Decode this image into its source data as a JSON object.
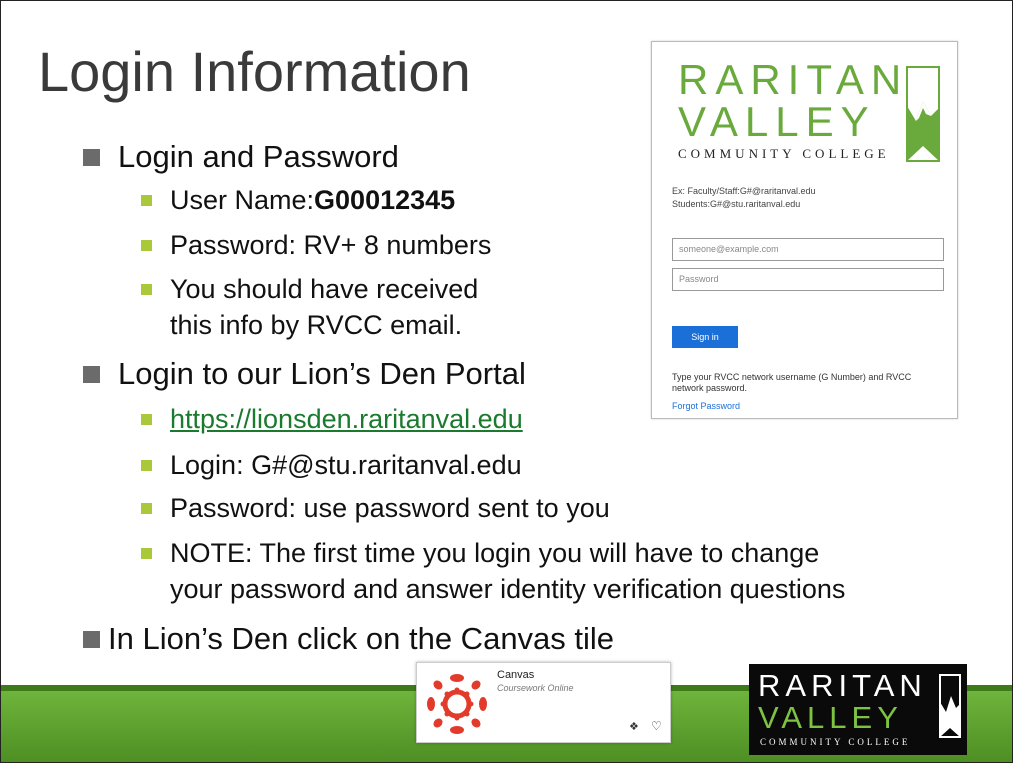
{
  "slide": {
    "title": "Login Information",
    "bullets": [
      {
        "text": "Login and Password"
      },
      {
        "text": "Login to our Lion’s Den Portal"
      },
      {
        "text": "In Lion’s Den click on the Canvas tile"
      }
    ],
    "sub1": {
      "username_label": "User Name: ",
      "username_value": "G00012345",
      "password": "Password: RV+ 8 numbers",
      "received_line1": "You should have received",
      "received_line2": "this info by RVCC email."
    },
    "sub2": {
      "url": "https://lionsden.raritanval.edu",
      "login": "Login: G#@stu.raritanval.edu",
      "password": "Password: use password sent to you",
      "note_line1": "NOTE: The first time you login you will have to change",
      "note_line2": "your password and answer identity verification questions"
    }
  },
  "login_card": {
    "logo_line1": "RARITAN",
    "logo_line2": "VALLEY",
    "logo_line3": "COMMUNITY COLLEGE",
    "hint_line1": "Ex: Faculty/Staff:G#@raritanval.edu",
    "hint_line2": "Students:G#@stu.raritanval.edu",
    "email_placeholder": "someone@example.com",
    "password_placeholder": "Password",
    "signin_label": "Sign in",
    "note": "Type your RVCC network username (G Number) and RVCC network password.",
    "forgot": "Forgot Password"
  },
  "canvas_tile": {
    "name": "Canvas",
    "subtitle": "Coursework Online",
    "info_icon": "info-icon",
    "favorite_icon": "heart-icon"
  },
  "footer_logo": {
    "line1": "RARITAN",
    "line2": "VALLEY",
    "line3": "COMMUNITY COLLEGE"
  },
  "colors": {
    "brand_green": "#6aaa3c",
    "band_green": "#5a9f2c",
    "bullet_gray": "#6b6b6b",
    "sub_bullet_green": "#a9c93a",
    "link_green": "#1a7a2e",
    "signin_blue": "#1a6fd8",
    "canvas_red": "#e23b2c"
  }
}
